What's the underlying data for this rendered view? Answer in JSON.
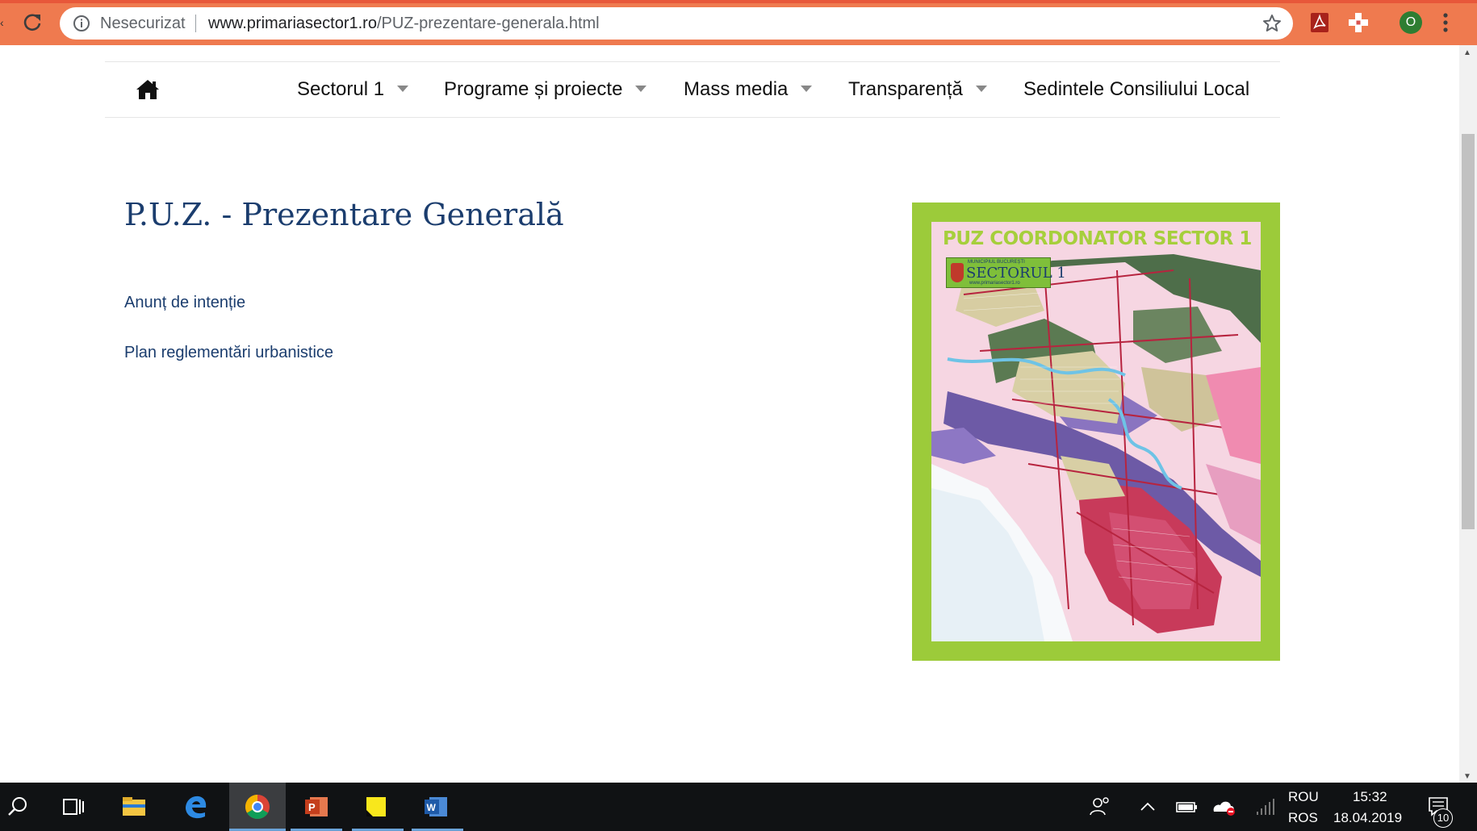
{
  "browser": {
    "security_label": "Nesecurizat",
    "url_host": "www.primariasector1.ro",
    "url_path": "/PUZ-prezentare-generala.html",
    "profile_initial": "O",
    "accent": "#ef7a4f"
  },
  "nav": {
    "items": [
      {
        "label": "Sectorul 1",
        "has_dropdown": true
      },
      {
        "label": "Programe și proiecte",
        "has_dropdown": true
      },
      {
        "label": "Mass media",
        "has_dropdown": true
      },
      {
        "label": "Transparență",
        "has_dropdown": true
      },
      {
        "label": "Sedintele Consiliului Local",
        "has_dropdown": false
      }
    ]
  },
  "main": {
    "title": "P.U.Z. - Prezentare Generală",
    "links": [
      {
        "label": "Anunț de intenție"
      },
      {
        "label": "Plan reglementări urbanistice"
      }
    ],
    "map_image": {
      "title": "PUZ COORDONATOR SECTOR 1",
      "badge_top": "MUNICIPIUL BUCUREȘTI",
      "badge_main": "SECTORUL 1",
      "badge_url": "www.primariasector1.ro"
    }
  },
  "taskbar": {
    "lang_top": "ROU",
    "lang_bottom": "ROS",
    "time": "15:32",
    "date": "18.04.2019",
    "notifications": "10"
  }
}
